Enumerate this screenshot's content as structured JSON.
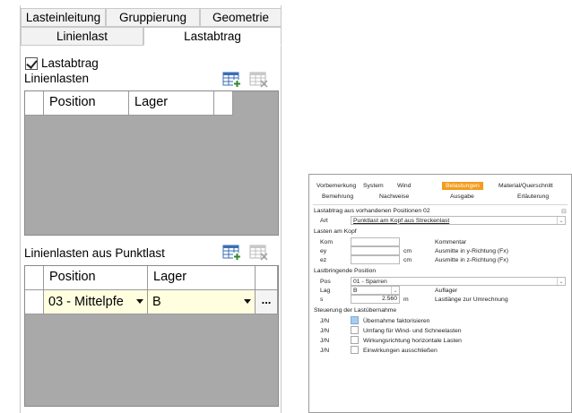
{
  "left_panel": {
    "tabs_row1": [
      "Lasteinleitung",
      "Gruppierung",
      "Geometrie"
    ],
    "tabs_row2": [
      "Linienlast",
      "Lastabtrag"
    ],
    "active_tab": "Lastabtrag",
    "lastabtrag_checkbox": {
      "label": "Lastabtrag",
      "checked": true
    },
    "section1": {
      "title": "Linienlasten",
      "columns": [
        "Position",
        "Lager"
      ]
    },
    "section2": {
      "title": "Linienlasten aus Punktlast",
      "columns": [
        "Position",
        "Lager"
      ],
      "rows": [
        {
          "position": "03 - Mittelpfe",
          "lager": "B",
          "more": "..."
        }
      ]
    },
    "icons": {
      "add": "table-add-icon",
      "delete": "table-delete-icon"
    }
  },
  "right_panel": {
    "tabs_row1": [
      "Vorbemerkung",
      "System",
      "Wind",
      "Belastungen",
      "Material/Querschnitt"
    ],
    "tabs_row2": [
      "Bemehrung",
      "Nachweise",
      "Ausgabe",
      "Erläuterung"
    ],
    "active_tab": "Belastungen",
    "heading": "Lastabtrag aus vorhandenen Positionen 02",
    "art": {
      "label": "Art",
      "value": "Punktlast am Kopf aus Streckenlast"
    },
    "lasten_am_kopf": {
      "title": "Lasten am Kopf",
      "rows": [
        {
          "label": "Kom",
          "value": "",
          "unit": "",
          "desc": "Kommentar"
        },
        {
          "label": "ey",
          "value": "",
          "unit": "cm",
          "desc": "Ausmitte in y-Richtung (Fx)"
        },
        {
          "label": "ez",
          "value": "",
          "unit": "cm",
          "desc": "Ausmitte in z-Richtung (Fx)"
        }
      ]
    },
    "lastbringende_position": {
      "title": "Lastbringende Position",
      "pos": {
        "label": "Pos",
        "value": "01 - Sparren"
      },
      "lag": {
        "label": "Lag",
        "value": "B",
        "desc": "Auflager"
      },
      "s": {
        "label": "s",
        "value": "2.560",
        "unit": "m",
        "desc": "Lastlänge zur Umrechnung"
      }
    },
    "steuerung": {
      "title": "Steuerung der Lastübernahme",
      "rows": [
        {
          "label": "J/N",
          "text": "Übernahme faktorisieren",
          "highlighted": true
        },
        {
          "label": "J/N",
          "text": "Umfang für Wind- und Schneelasten",
          "highlighted": false
        },
        {
          "label": "J/N",
          "text": "Wirkungsrichtung horizontale Lasten",
          "highlighted": false
        },
        {
          "label": "J/N",
          "text": "Einwirkungen ausschließen",
          "highlighted": false
        }
      ]
    },
    "colors": {
      "accent": "#f39c1e",
      "highlight": "#a9cdf0"
    }
  }
}
